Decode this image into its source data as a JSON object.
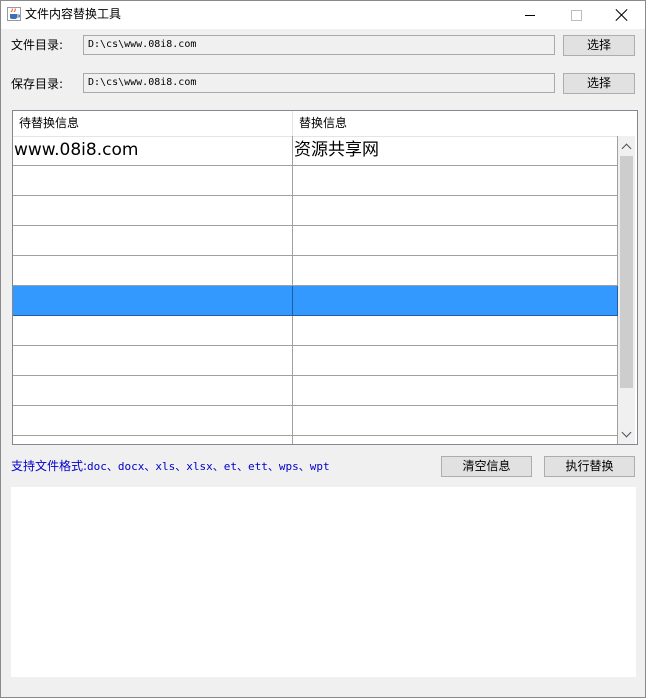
{
  "window": {
    "title": "文件内容替换工具",
    "icon": "java-cup-icon"
  },
  "source": {
    "label": "文件目录:",
    "value": "D:\\cs\\www.08i8.com",
    "button_label": "选择"
  },
  "target": {
    "label": "保存目录:",
    "value": "D:\\cs\\www.08i8.com",
    "button_label": "选择"
  },
  "table": {
    "columns": [
      "待替换信息",
      "替换信息"
    ],
    "rows": [
      [
        "www.08i8.com",
        "资源共享网"
      ],
      [
        "",
        ""
      ],
      [
        "",
        ""
      ],
      [
        "",
        ""
      ],
      [
        "",
        ""
      ],
      [
        "",
        ""
      ],
      [
        "",
        ""
      ],
      [
        "",
        ""
      ],
      [
        "",
        ""
      ],
      [
        "",
        ""
      ],
      [
        "",
        ""
      ]
    ],
    "selected_row_index": 5,
    "selection_color": "#3399ff"
  },
  "formats": {
    "label": "支持文件格式:",
    "list": "doc、docx、xls、xlsx、et、ett、wps、wpt",
    "color": "#0000cc"
  },
  "actions": {
    "clear_label": "清空信息",
    "execute_label": "执行替换"
  },
  "log": {
    "text": ""
  }
}
